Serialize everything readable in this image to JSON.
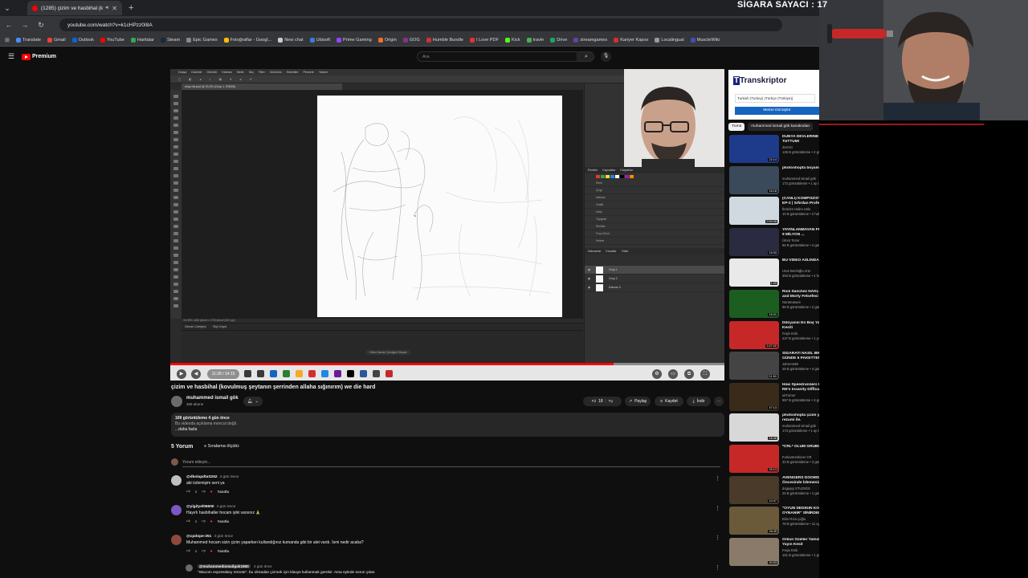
{
  "browser": {
    "tab_title": "(1285) çizim ve hasbihal (k...",
    "url": "youtube.com/watch?v=k1cHPzz0I8A",
    "bookmarks": [
      {
        "label": "Translate",
        "color": "#4a8cff"
      },
      {
        "label": "Gmail",
        "color": "#ea4335"
      },
      {
        "label": "Outlook",
        "color": "#0a64d6"
      },
      {
        "label": "YouTube",
        "color": "#ff0000"
      },
      {
        "label": "Haritalar",
        "color": "#34a853"
      },
      {
        "label": "Steam",
        "color": "#1b2838"
      },
      {
        "label": "Epic Games",
        "color": "#888888"
      },
      {
        "label": "Fotoğraflar - Googl...",
        "color": "#fbbc05"
      },
      {
        "label": "New chat",
        "color": "#cccccc"
      },
      {
        "label": "Ubisoft",
        "color": "#3a7bd5"
      },
      {
        "label": "Prime Gaming",
        "color": "#9146ff"
      },
      {
        "label": "Origin",
        "color": "#f56c2d"
      },
      {
        "label": "GOG",
        "color": "#86328a"
      },
      {
        "label": "Humble Bundle",
        "color": "#cc3333"
      },
      {
        "label": "I Love PDF",
        "color": "#e5322d"
      },
      {
        "label": "Kick",
        "color": "#53fc18"
      },
      {
        "label": "travle",
        "color": "#4caf50"
      },
      {
        "label": "Drive",
        "color": "#1fa463"
      },
      {
        "label": "streamgames",
        "color": "#6441a5"
      },
      {
        "label": "Kariyer Kapısı",
        "color": "#d32f2f"
      },
      {
        "label": "Localingual",
        "color": "#999999"
      },
      {
        "label": "MuscleWiki",
        "color": "#3f51b5"
      }
    ]
  },
  "youtube": {
    "premium_label": "Premium",
    "search_placeholder": "Ara"
  },
  "video": {
    "progress": 0.8,
    "time": "11:28 / 14:15",
    "title": "çizim ve hasbihal (kovulmuş şeytanın şerrinden allaha sığınırım) we die hard",
    "channel": "muhammed ismail gök",
    "subs": "369 abone",
    "likes": "18",
    "share": "Paylaş",
    "save": "Kaydet",
    "download": "İndir",
    "desc_views": "169 görüntüleme  4 gün önce",
    "desc_text": "Bu videoda açıklama mevcut değil.",
    "desc_more": "...daha fazla"
  },
  "photoshop": {
    "menu": [
      "Dosya",
      "Düzenle",
      "Görüntü",
      "Katman",
      "Metin",
      "Seç",
      "Filtre",
      "Görünüm",
      "Eklentiler",
      "Pencere",
      "Yardım"
    ],
    "doc_tab": "sinyo bit.psd @ 33,3% (Grup 1, RGB/8)",
    "status": "33,33%   1485 piksel x 1790 piksel (300 ppi)",
    "timeline_tabs": [
      "Zaman Çizelgesi",
      "Ölçü Kaydı"
    ],
    "timeline_button": "Video Zaman Çizelgesi Oluştur",
    "right_panels": [
      "Renkler",
      "Kaynaklar",
      "Kitaplıklar"
    ],
    "layers_panel": [
      "Katmanlar",
      "Kanallar",
      "Yollar"
    ],
    "layers": [
      "Grup 1",
      "Grup 2",
      "Katman 0"
    ],
    "library_items": [
      "Renk",
      "Çizgi",
      "Katman",
      "Grafik",
      "Kalıp",
      "Tipografi",
      "Renkler",
      "Fırça Gözü",
      "Kelime"
    ]
  },
  "comments": {
    "count": "5 Yorum",
    "sort": "Sıralama ölçütü",
    "add_placeholder": "Yorum ekleyin...",
    "reply": "Yanıtla",
    "items": [
      {
        "user": "@dkolapdtaS252",
        "time": "4 gün önce",
        "text": "abi özlemişim seni ya",
        "likes": "1",
        "avatar": "#c0c0c0"
      },
      {
        "user": "@yigityel06600",
        "time": "4 gün önce",
        "text": "Hayırlı hasbihaller hocam iyiki varsınız 🙏",
        "likes": "1",
        "avatar": "#7e57c2"
      },
      {
        "user": "@cpdope-251",
        "time": "4 gün önce",
        "text": "Muhammed hocam sizin çizim yaparken kullandığınız kumanda gibi bir alet vardı. İsmi nedir acaba?",
        "likes": "1",
        "avatar": "#8d4a3a"
      }
    ],
    "reply_user": "@muhammedismailgok1960",
    "reply_time": "4 gün önce",
    "reply_text": "\"Wacom expresskey remote\". bu olmadan çizmek için klavye kullanmak gerekir. Ama öylede sorun çıkar."
  },
  "sidebar": {
    "ad": {
      "logo": "Transkriptor",
      "language": "Turkish (Turkey) (Türkçe (Türkiye))",
      "button": "Metne Dönüştür"
    },
    "chips": [
      "Tümü",
      "muhammed ismail gök kanalından"
    ],
    "videos": [
      {
        "title": "DÜNYA DEVLERİNE RAKİP TUTTUM!",
        "channel": "ZeroGi",
        "meta": "126 B görüntüleme • 2 gün önce",
        "duration": "22:14",
        "bg": "#1e3a8a"
      },
      {
        "title": "photoshopta boyama yaptım",
        "channel": "muhammed ismail gök",
        "meta": "173 görüntüleme • 1 ay önce",
        "duration": "16:18",
        "bg": "#3a4a5a"
      },
      {
        "title": "(CANLI) KOMPOZİSYON NEDİR? EP-2 | Sıfırdan Profesyonelliğe",
        "channel": "İbrahim Halim Uslu",
        "meta": "10 B görüntüleme • 2 hafta önce",
        "duration": "2:53:06",
        "bg": "#d0d8e0"
      },
      {
        "title": "YAYINLANMAYAN FRAGMANDAKİ 9 MİLYON ...",
        "channel": "Ümür Tezer",
        "meta": "86 B görüntüleme • 4 gün önce",
        "duration": "15:33",
        "bg": "#2a2a40"
      },
      {
        "title": "BU VİDEO ASLINDA 6 DAKİKA!",
        "channel": "Uraz Benfoğlu Arts",
        "meta": "393 B görüntüleme • 4 hafta önce",
        "duration": "1:09",
        "bg": "#e9e9e9"
      },
      {
        "title": "Rick Sanchez HAKLI MI? | Rick and Morty Felsefesi",
        "channel": "Nontreasure",
        "meta": "96 B görüntüleme • 2 gün önce",
        "duration": "16:01",
        "bg": "#1b5e20"
      },
      {
        "title": "Dünyanın En Boş Yayını! | Yayın Kesiti",
        "channel": "Feşiv Enik",
        "meta": "247 B görüntüleme • 1 yıl önce",
        "duration": "2:27:02",
        "bg": "#c62828"
      },
      {
        "title": "SİGARAYI NASIL BIRAKTIM? GÜNDE 5 PAKETTEN SIFIR ...",
        "channel": "Jahrenn98",
        "meta": "28 B görüntüleme • 3 gün önce",
        "duration": "11:51",
        "bg": "#444444"
      },
      {
        "title": "How Speedrunners DESTROYED RE's Insanity Difficulty",
        "channel": "ukTurner",
        "meta": "967 B görüntüleme • 3 gün önce",
        "duration": "47:13",
        "bg": "#3a2a1a"
      },
      {
        "title": "photoshopta çizim yaptım. lazzy rezumi ile.",
        "channel": "muhammed ismail gök",
        "meta": "173 görüntüleme • 1 ay önce",
        "duration": "18:46",
        "bg": "#d8d8d8"
      },
      {
        "title": "*CRL* ÖLÜM GRUBU MAÇLARIM!*",
        "channel": "FurkanKeskiner CR",
        "meta": "33 B görüntüleme • 3 gün önce",
        "duration": "33:13",
        "bg": "#c62828"
      },
      {
        "title": "AVENGERS DOOMSDAY Öncesinde İzlemeniz Gereken ...",
        "channel": "dogaşıp STUDIOS",
        "meta": "25 B görüntüleme • 1 gün önce",
        "duration": "10:47",
        "bg": "#4a3a2a"
      },
      {
        "title": "\"OYUN DEDİĞİN KORSAN OYNANIR\" SİNİRDEN ...",
        "channel": "Ekin Rıza çoğlu",
        "meta": "78 B görüntüleme • 11 ay önce",
        "duration": "26:45",
        "bg": "#6a5a3a"
      },
      {
        "title": "Orkun Özeller Yalnız Değildir! | Yayın Kesit",
        "channel": "Feşiv Enik",
        "meta": "161 B görüntüleme • 1 gün önce",
        "duration": "40:53",
        "bg": "#8a7a6a"
      }
    ]
  },
  "overlay": {
    "counter_label": "SİGARA SAYACI : 17"
  }
}
